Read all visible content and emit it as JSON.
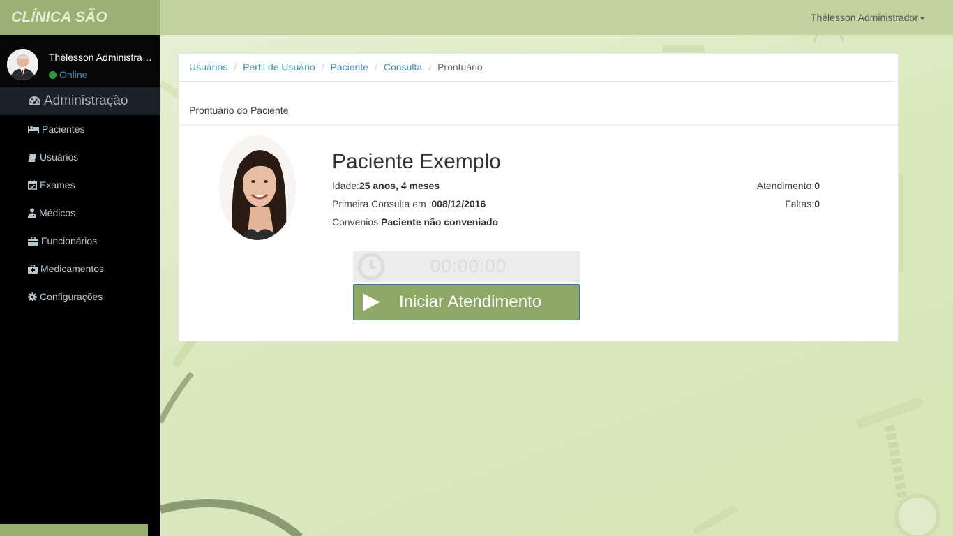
{
  "brand": {
    "title": "CLÍNICA SÃO LUCAS"
  },
  "topbar": {
    "user_menu_label": "Thélesson Administrador"
  },
  "sidebar": {
    "user": {
      "name": "Thélesson Administrador",
      "status": "Online"
    },
    "header_label": "Administração",
    "items": [
      {
        "label": "Pacientes",
        "icon": "bed-icon"
      },
      {
        "label": "Usuários",
        "icon": "book-icon"
      },
      {
        "label": "Exames",
        "icon": "calendar-check-icon"
      },
      {
        "label": "Médicos",
        "icon": "user-md-icon"
      },
      {
        "label": "Funcionários",
        "icon": "briefcase-icon"
      },
      {
        "label": "Medicamentos",
        "icon": "medkit-icon"
      },
      {
        "label": "Configurações",
        "icon": "gear-icon"
      }
    ]
  },
  "breadcrumb": {
    "items": [
      "Usuários",
      "Perfil de Usuário",
      "Paciente",
      "Consulta"
    ],
    "current": "Prontuário"
  },
  "panel": {
    "title": "Prontuário do Paciente"
  },
  "patient": {
    "name": "Paciente Exemplo",
    "age_label": "Idade:",
    "age_value": "25 anos, 4 meses",
    "first_visit_label": "Primeira Consulta em :",
    "first_visit_value": "008/12/2016",
    "insurance_label": "Convenios:",
    "insurance_value": "Paciente não conveniado",
    "attendance_label": "Atendimento:",
    "attendance_value": "0",
    "absences_label": "Faltas:",
    "absences_value": "0"
  },
  "timer": {
    "value": "00:00:00"
  },
  "actions": {
    "start_label": "Iniciar Atendimento"
  },
  "colors": {
    "brand": "#9bb073",
    "topbar": "#c2d29f",
    "sidebar": "#000000",
    "link": "#3c8dbc",
    "start_button": "#8ea868"
  }
}
